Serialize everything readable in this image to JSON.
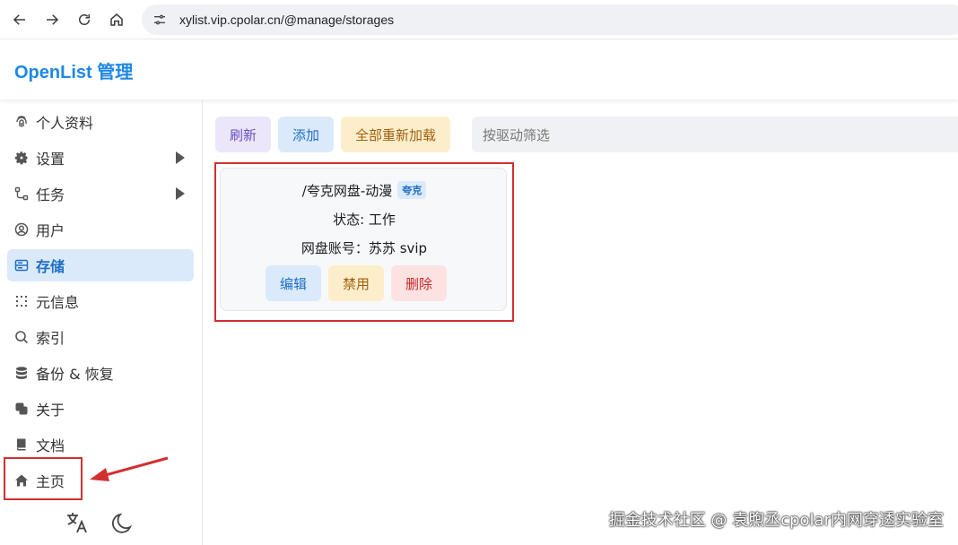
{
  "browser": {
    "url": "xylist.vip.cpolar.cn/@manage/storages"
  },
  "header": {
    "title": "OpenList 管理"
  },
  "sidebar": {
    "items": [
      {
        "label": "个人资料",
        "icon": "fingerprint-icon"
      },
      {
        "label": "设置",
        "icon": "gear-icon",
        "expandable": true
      },
      {
        "label": "任务",
        "icon": "workflow-icon",
        "expandable": true
      },
      {
        "label": "用户",
        "icon": "user-circle-icon"
      },
      {
        "label": "存储",
        "icon": "storage-icon",
        "active": true
      },
      {
        "label": "元信息",
        "icon": "metadata-icon"
      },
      {
        "label": "索引",
        "icon": "search-icon"
      },
      {
        "label": "备份 & 恢复",
        "icon": "database-icon"
      },
      {
        "label": "关于",
        "icon": "copy-icon"
      },
      {
        "label": "文档",
        "icon": "book-icon"
      },
      {
        "label": "主页",
        "icon": "home-icon"
      }
    ]
  },
  "toolbar": {
    "refresh": "刷新",
    "add": "添加",
    "reload_all": "全部重新加载",
    "filter_placeholder": "按驱动筛选"
  },
  "storage_card": {
    "path": "/夸克网盘-动漫",
    "badge": "夸克",
    "status": "状态: 工作",
    "account": "网盘账号：苏苏 svip",
    "edit": "编辑",
    "disable": "禁用",
    "delete": "删除"
  },
  "watermark": "掘金技术社区 @ 袁煦丞cpolar内网穿透实验室",
  "colors": {
    "accent": "#1e88e5",
    "active_bg": "#dbeafb",
    "annotation_red": "#d32f2f"
  }
}
